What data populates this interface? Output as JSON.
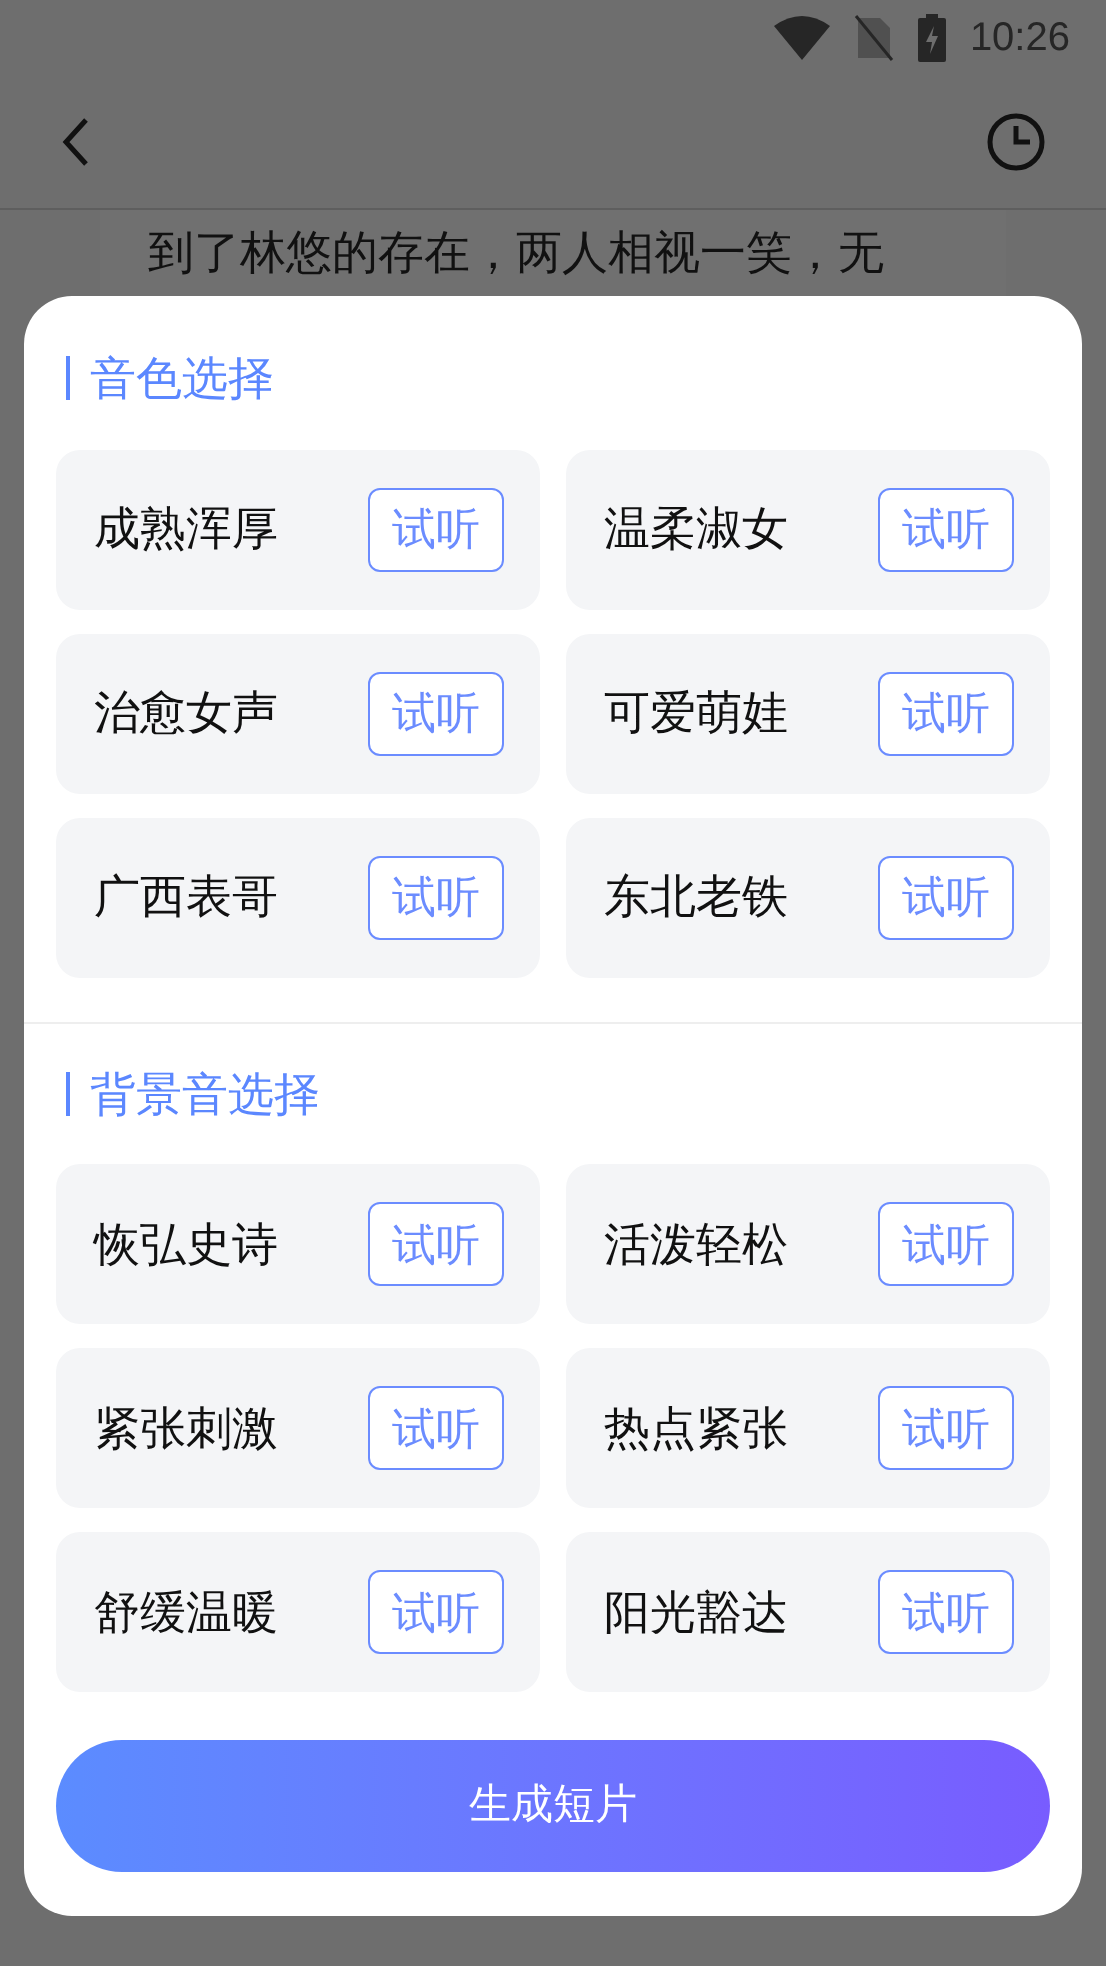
{
  "status_bar": {
    "time": "10:26"
  },
  "page": {
    "text": "到了林悠的存在，两人相视一笑，无"
  },
  "sheet": {
    "sections": [
      {
        "title": "音色选择",
        "items": [
          {
            "label": "成熟浑厚",
            "action": "试听"
          },
          {
            "label": "温柔淑女",
            "action": "试听"
          },
          {
            "label": "治愈女声",
            "action": "试听"
          },
          {
            "label": "可爱萌娃",
            "action": "试听"
          },
          {
            "label": "广西表哥",
            "action": "试听"
          },
          {
            "label": "东北老铁",
            "action": "试听"
          }
        ]
      },
      {
        "title": "背景音选择",
        "items": [
          {
            "label": "恢弘史诗",
            "action": "试听"
          },
          {
            "label": "活泼轻松",
            "action": "试听"
          },
          {
            "label": "紧张刺激",
            "action": "试听"
          },
          {
            "label": "热点紧张",
            "action": "试听"
          },
          {
            "label": "舒缓温暖",
            "action": "试听"
          },
          {
            "label": "阳光豁达",
            "action": "试听"
          }
        ]
      }
    ],
    "primary_button": "生成短片"
  }
}
